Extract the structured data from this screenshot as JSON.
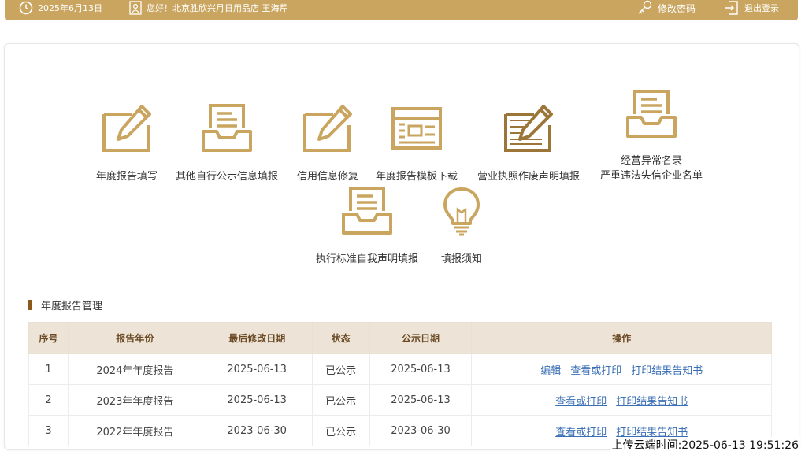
{
  "topbar": {
    "date": "2025年6月13日",
    "greeting": "您好！北京胜欣兴月日用品店 王海芹",
    "change_password": "修改密码",
    "logout": "退出登录"
  },
  "entries": [
    {
      "label": "年度报告填写",
      "icon": "edit-pen-icon"
    },
    {
      "label": "其他自行公示信息填报",
      "icon": "inbox-tray-icon"
    },
    {
      "label": "信用信息修复",
      "icon": "edit-pen-icon"
    },
    {
      "label": "年度报告模板下载",
      "icon": "template-form-icon"
    },
    {
      "label": "营业执照作废声明填报",
      "icon": "edit-pen-hatched-icon"
    },
    {
      "label": "经营异常名录",
      "label2": "严重违法失信企业名单",
      "icon": "inbox-tray-icon"
    },
    {
      "label": "执行标准自我声明填报",
      "icon": "inbox-tray-icon"
    },
    {
      "label": "填报须知",
      "icon": "lightbulb-icon"
    }
  ],
  "section": {
    "title": "年度报告管理"
  },
  "table": {
    "headers": [
      "序号",
      "报告年份",
      "最后修改日期",
      "状态",
      "公示日期",
      "操作"
    ],
    "rows": [
      {
        "no": "1",
        "year": "2024年年度报告",
        "modified": "2025-06-13",
        "status": "已公示",
        "published": "2025-06-13",
        "actions": [
          "编辑",
          "查看或打印",
          "打印结果告知书"
        ]
      },
      {
        "no": "2",
        "year": "2023年年度报告",
        "modified": "2025-06-13",
        "status": "已公示",
        "published": "2025-06-13",
        "actions": [
          "查看或打印",
          "打印结果告知书"
        ]
      },
      {
        "no": "3",
        "year": "2022年年度报告",
        "modified": "2023-06-30",
        "status": "已公示",
        "published": "2023-06-30",
        "actions": [
          "查看或打印",
          "打印结果告知书"
        ]
      }
    ]
  },
  "watermark": "上传云端时间:2025-06-13 19:51:26",
  "colors": {
    "gold": "#c9a55f",
    "header_bg": "#ede3d6",
    "link": "#3a6fb5"
  }
}
